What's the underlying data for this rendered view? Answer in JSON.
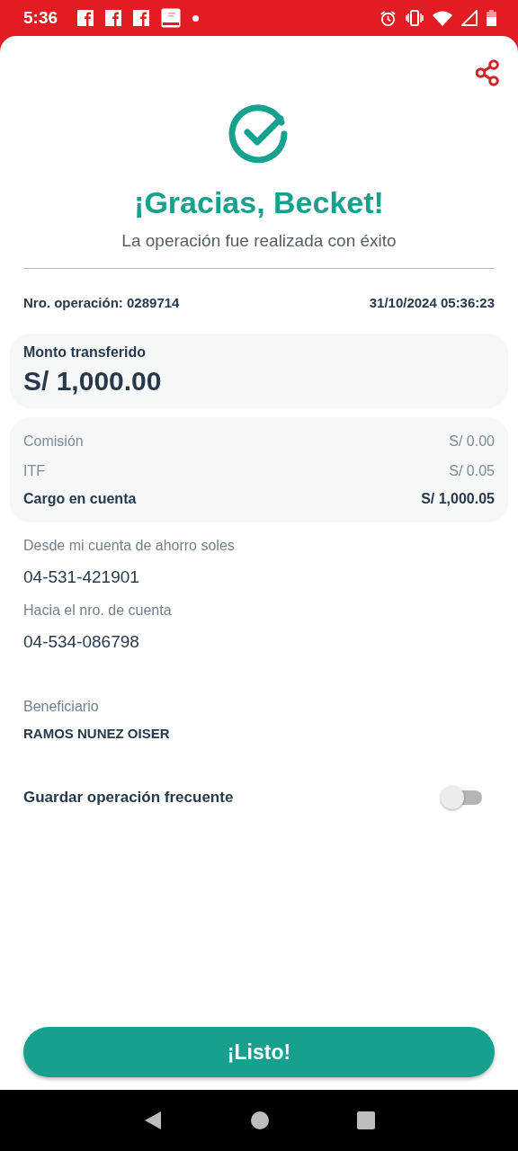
{
  "status_bar": {
    "time": "5:36"
  },
  "header": {
    "title": "¡Gracias, Becket!",
    "subtitle": "La operación fue realizada con éxito"
  },
  "operation": {
    "number": "Nro. operación: 0289714",
    "datetime": "31/10/2024 05:36:23"
  },
  "amount": {
    "label": "Monto transferido",
    "value": "S/ 1,000.00"
  },
  "charges": [
    {
      "label": "Comisión",
      "value": "S/ 0.00",
      "total": false
    },
    {
      "label": "ITF",
      "value": "S/ 0.05",
      "total": false
    },
    {
      "label": "Cargo en cuenta",
      "value": "S/ 1,000.05",
      "total": true
    }
  ],
  "details": [
    {
      "label": "Desde mi cuenta de ahorro soles",
      "value": "04-531-421901",
      "kind": "account"
    },
    {
      "label": "Hacia el nro. de cuenta",
      "value": "04-534-086798",
      "kind": "account"
    },
    {
      "label": "Beneficiario",
      "value": "RAMOS NUNEZ OISER",
      "kind": "name"
    }
  ],
  "save_frequent": {
    "label": "Guardar operación frecuente",
    "on": false
  },
  "done_button": {
    "label": "¡Listo!"
  }
}
